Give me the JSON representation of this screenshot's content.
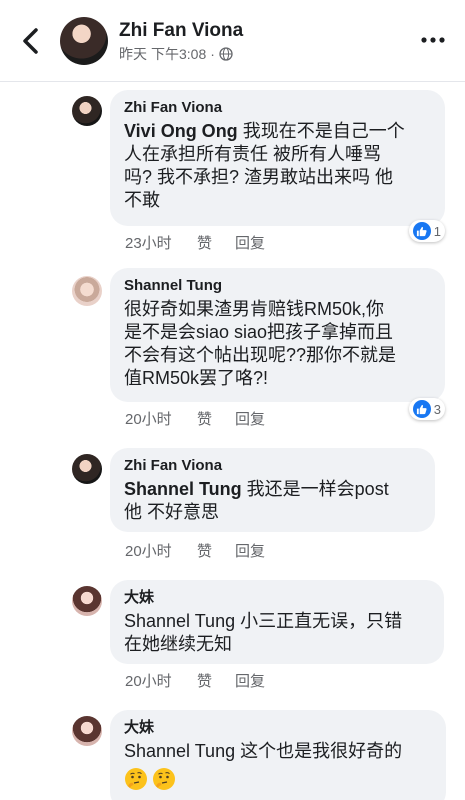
{
  "header": {
    "name": "Zhi Fan Viona",
    "day": "昨天",
    "time": "下午3:08"
  },
  "comments": [
    {
      "name": "Zhi Fan Viona",
      "mention": "Vivi Ong Ong",
      "text": " 我现在不是自己一个\n人在承担所有责任 被所有人唾骂\n吗? 我不承担? 渣男敢站出来吗 他\n不敢",
      "time": "23小时",
      "like": "赞",
      "reply": "回复",
      "reactions": "1"
    },
    {
      "name": "Shannel Tung",
      "mention": "",
      "text": "很好奇如果渣男肯赔钱RM50k,你\n是不是会siao siao把孩子拿掉而且\n不会有这个帖出现呢??那你不就是\n值RM50k罢了咯?!",
      "time": "20小时",
      "like": "赞",
      "reply": "回复",
      "reactions": "3"
    },
    {
      "name": "Zhi Fan Viona",
      "mention": "Shannel Tung",
      "text": " 我还是一样会post\n他 不好意思",
      "time": "20小时",
      "like": "赞",
      "reply": "回复",
      "reactions": ""
    },
    {
      "name": "大妹",
      "mention": "",
      "text": "Shannel Tung 小三正直无误，只错\n在她继续无知",
      "time": "20小时",
      "like": "赞",
      "reply": "回复",
      "reactions": ""
    },
    {
      "name": "大妹",
      "mention": "",
      "text": "Shannel Tung 这个也是我很好奇的",
      "time": "",
      "like": "",
      "reply": "",
      "reactions": ""
    }
  ],
  "icons": {
    "back": "chevron-left-icon",
    "globe": "globe-icon",
    "more": "more-dots-icon",
    "like": "thumbs-up-icon",
    "emoji": "thinking-face-emoji"
  },
  "colors": {
    "accent": "#1877f2",
    "bubble": "#f0f2f5",
    "meta": "#65676b"
  }
}
